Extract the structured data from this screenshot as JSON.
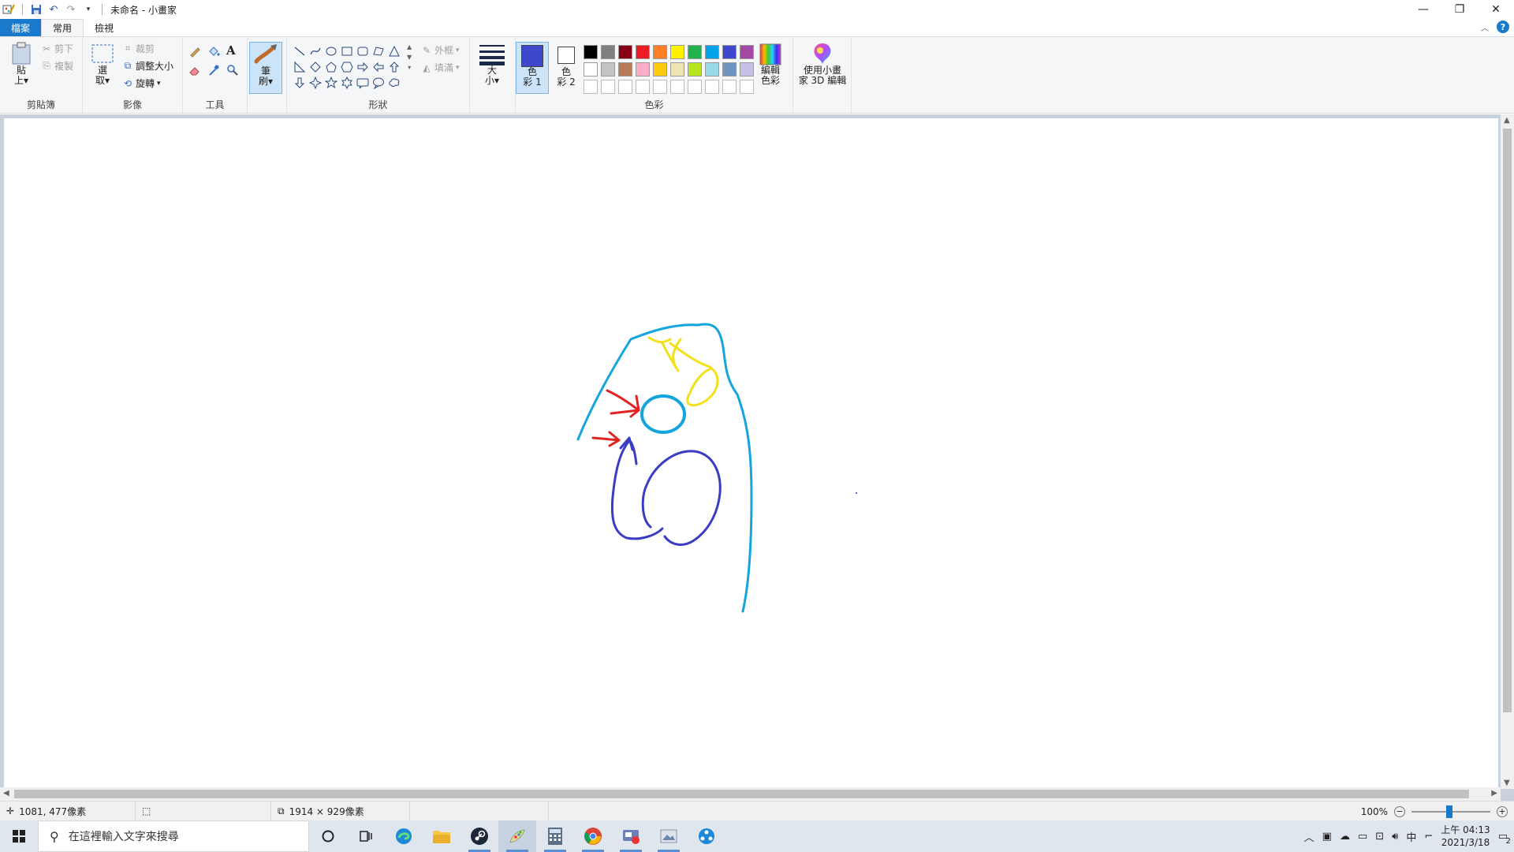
{
  "window": {
    "title": "未命名 - 小畫家",
    "controls": [
      "minimize",
      "restore",
      "close"
    ]
  },
  "tabs": [
    {
      "label": "檔案"
    },
    {
      "label": "常用"
    },
    {
      "label": "檢視"
    }
  ],
  "ribbon": {
    "clipboard": {
      "group_label": "剪貼簿",
      "paste_label_1": "貼",
      "paste_label_2": "上",
      "cut_label": "剪下",
      "copy_label": "複製"
    },
    "image": {
      "group_label": "影像",
      "select_label_1": "選",
      "select_label_2": "取",
      "crop_label": "裁剪",
      "resize_label": "調整大小",
      "rotate_label": "旋轉"
    },
    "tools": {
      "group_label": "工具"
    },
    "brushes": {
      "label_1": "筆",
      "label_2": "刷"
    },
    "shapes": {
      "group_label": "形狀",
      "outline_label": "外框",
      "fill_label": "填滿",
      "items": [
        "line",
        "curve",
        "oval",
        "rectangle",
        "rounded-rectangle",
        "polygon",
        "triangle",
        "right-triangle",
        "diamond",
        "pentagon",
        "hexagon",
        "right-arrow",
        "left-arrow",
        "up-arrow",
        "down-arrow",
        "four-point-star",
        "five-point-star",
        "six-point-star",
        "rounded-callout",
        "oval-callout",
        "cloud-callout"
      ]
    },
    "size": {
      "label_1": "大",
      "label_2": "小"
    },
    "colors": {
      "group_label": "色彩",
      "color1_label_1": "色",
      "color1_label_2": "彩 1",
      "color2_label_1": "色",
      "color2_label_2": "彩 2",
      "color1_value": "#3f48cc",
      "color2_value": "#ffffff",
      "edit_colors_label_1": "編輯",
      "edit_colors_label_2": "色彩",
      "palette_row1": [
        "#000000",
        "#7f7f7f",
        "#880015",
        "#ed1c24",
        "#ff7f27",
        "#fff200",
        "#22b14c",
        "#00a2e8",
        "#3f48cc",
        "#a349a4"
      ],
      "palette_row2": [
        "#ffffff",
        "#c3c3c3",
        "#b97a57",
        "#ffaec9",
        "#ffc90e",
        "#efe4b0",
        "#b5e61d",
        "#99d9ea",
        "#7092be",
        "#c8bfe7"
      ]
    },
    "paint3d": {
      "label_1": "使用小畫",
      "label_2": "家 3D 編輯"
    }
  },
  "status": {
    "cursor_pos": "1081, 477像素",
    "canvas_size": "1914 × 929像素",
    "zoom": "100%"
  },
  "taskbar": {
    "search_placeholder": "在這裡輸入文字來搜尋",
    "apps": [
      "cortana-icon",
      "task-view-icon",
      "edge-icon",
      "file-explorer-icon",
      "steam-icon",
      "paint-icon",
      "calculator-icon",
      "chrome-icon",
      "video-editor-icon",
      "photos-icon",
      "network-app-icon"
    ],
    "ime": "中",
    "time": "上午 04:13",
    "date": "2021/3/18",
    "notifications": "2"
  }
}
